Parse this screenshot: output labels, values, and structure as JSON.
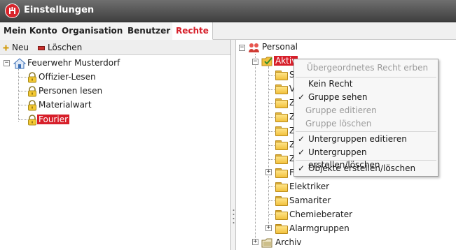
{
  "window": {
    "title": "Einstellungen"
  },
  "tabs": [
    {
      "label": "Mein Konto",
      "active": false
    },
    {
      "label": "Organisation",
      "active": false
    },
    {
      "label": "Benutzer",
      "active": false
    },
    {
      "label": "Rechte",
      "active": true
    }
  ],
  "toolbar": {
    "new_label": "Neu",
    "delete_label": "Löschen"
  },
  "left_tree": {
    "root": "Feuerwehr Musterdorf",
    "children": [
      "Offizier-Lesen",
      "Personen lesen",
      "Materialwart",
      "Fourier"
    ],
    "selected": "Fourier"
  },
  "right_tree": {
    "root": "Personal",
    "selected_child": "Aktiv",
    "hidden_children_initials": [
      "S",
      "V",
      "Z",
      "Z",
      "Z",
      "Z",
      "Z",
      "F"
    ],
    "visible_children": [
      "Elektriker",
      "Samariter",
      "Chemieberater",
      "Alarmgruppen"
    ],
    "archive": "Archiv"
  },
  "context_menu": {
    "items": [
      {
        "label": "Übergeordnetes Recht erben",
        "checked": false,
        "disabled": true
      },
      {
        "label": "Kein Recht",
        "checked": false,
        "disabled": false
      },
      {
        "label": "Gruppe sehen",
        "checked": true,
        "disabled": false
      },
      {
        "label": "Gruppe editieren",
        "checked": false,
        "disabled": true
      },
      {
        "label": "Gruppe löschen",
        "checked": false,
        "disabled": true
      },
      {
        "label": "Untergruppen editieren",
        "checked": true,
        "disabled": false
      },
      {
        "label": "Untergruppen erstellen/löschen",
        "checked": true,
        "disabled": false
      },
      {
        "label": "Objekte erstellen/löschen",
        "checked": true,
        "disabled": false
      }
    ],
    "check_glyph": "✓"
  },
  "colors": {
    "accent": "#d71f2a",
    "titlebar": "#4f4f4f",
    "folder": "#f2c13d"
  },
  "icons": [
    "app-logo-icon",
    "plus-icon",
    "delete-icon",
    "house-icon",
    "lock-icon",
    "folder-icon",
    "check-folder-icon",
    "people-icon",
    "archive-icon"
  ]
}
